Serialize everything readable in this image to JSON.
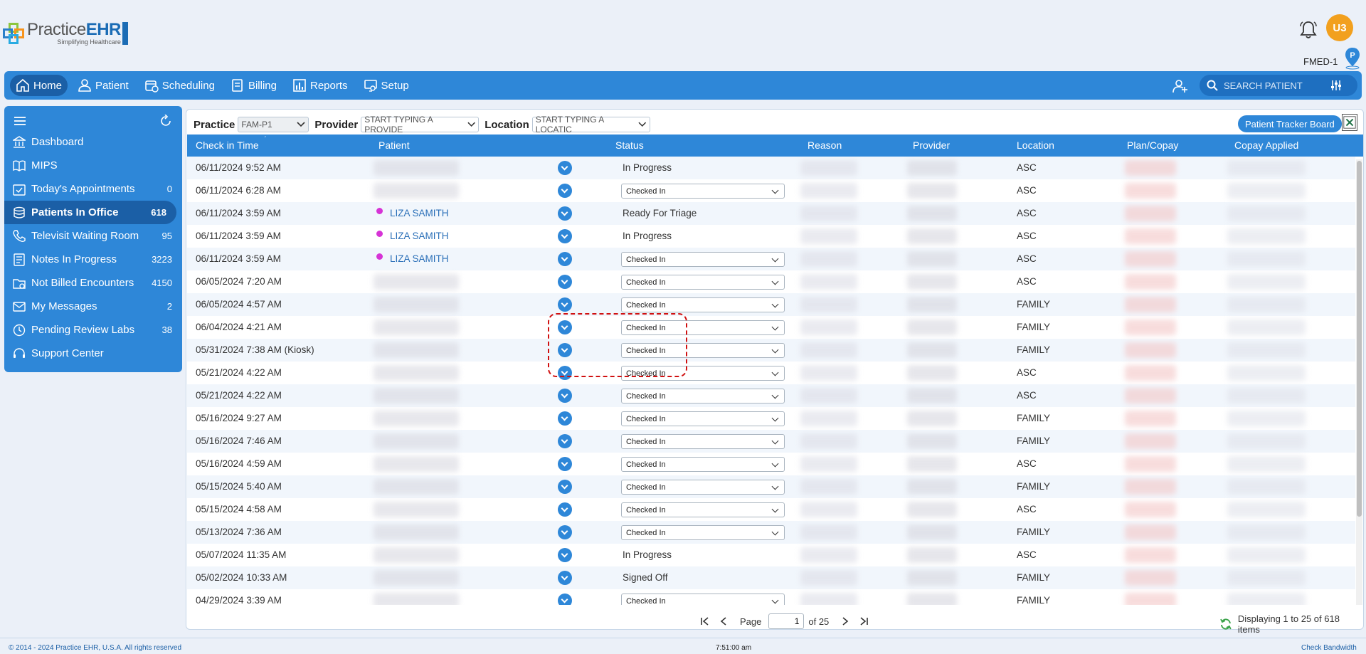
{
  "app": {
    "brand_practice": "Practice",
    "brand_ehr": "EHR",
    "tagline": "Simplifying Healthcare",
    "user_initials": "U3",
    "facility": "FMED-1",
    "pin_letter": "P"
  },
  "nav": {
    "items": [
      {
        "label": "Home",
        "icon": "home-icon"
      },
      {
        "label": "Patient",
        "icon": "user-icon"
      },
      {
        "label": "Scheduling",
        "icon": "calendar-icon"
      },
      {
        "label": "Billing",
        "icon": "billing-icon"
      },
      {
        "label": "Reports",
        "icon": "chart-icon"
      },
      {
        "label": "Setup",
        "icon": "setup-icon"
      }
    ],
    "search_placeholder": "SEARCH PATIENT"
  },
  "sidebar": {
    "items": [
      {
        "label": "Dashboard",
        "count": ""
      },
      {
        "label": "MIPS",
        "count": ""
      },
      {
        "label": "Today's Appointments",
        "count": "0"
      },
      {
        "label": "Patients In Office",
        "count": "618"
      },
      {
        "label": "Televisit Waiting Room",
        "count": "95"
      },
      {
        "label": "Notes In Progress",
        "count": "3223"
      },
      {
        "label": "Not Billed Encounters",
        "count": "4150"
      },
      {
        "label": "My Messages",
        "count": "2"
      },
      {
        "label": "Pending Review Labs",
        "count": "38"
      },
      {
        "label": "Support Center",
        "count": ""
      }
    ]
  },
  "filters": {
    "practice_label": "Practice",
    "practice_value": "FAM-P1",
    "provider_label": "Provider",
    "provider_placeholder": "START TYPING A PROVIDE",
    "location_label": "Location",
    "location_placeholder": "START TYPING A LOCATIC",
    "tracker_button": "Patient Tracker Board"
  },
  "table": {
    "columns": [
      "Check in Time",
      "Patient",
      "Status",
      "Reason",
      "Provider",
      "Location",
      "Plan/Copay",
      "Copay Applied"
    ],
    "rows": [
      {
        "time": "06/11/2024 9:52 AM",
        "patient": "",
        "status": "In Progress",
        "status_type": "text",
        "location": "ASC"
      },
      {
        "time": "06/11/2024 6:28 AM",
        "patient": "",
        "status": "Checked In",
        "status_type": "select",
        "location": "ASC"
      },
      {
        "time": "06/11/2024 3:59 AM",
        "patient": "LIZA SAMITH",
        "status": "Ready For Triage",
        "status_type": "text",
        "location": "ASC"
      },
      {
        "time": "06/11/2024 3:59 AM",
        "patient": "LIZA SAMITH",
        "status": "In Progress",
        "status_type": "text",
        "location": "ASC"
      },
      {
        "time": "06/11/2024 3:59 AM",
        "patient": "LIZA SAMITH",
        "status": "Checked In",
        "status_type": "select",
        "location": "ASC"
      },
      {
        "time": "06/05/2024 7:20 AM",
        "patient": "",
        "status": "Checked In",
        "status_type": "select",
        "location": "ASC"
      },
      {
        "time": "06/05/2024 4:57 AM",
        "patient": "",
        "status": "Checked In",
        "status_type": "select",
        "location": "FAMILY"
      },
      {
        "time": "06/04/2024 4:21 AM",
        "patient": "",
        "status": "Checked In",
        "status_type": "select",
        "location": "FAMILY"
      },
      {
        "time": "05/31/2024 7:38 AM (Kiosk)",
        "patient": "",
        "status": "Checked In",
        "status_type": "select",
        "location": "FAMILY"
      },
      {
        "time": "05/21/2024 4:22 AM",
        "patient": "",
        "status": "Checked In",
        "status_type": "select",
        "location": "ASC"
      },
      {
        "time": "05/21/2024 4:22 AM",
        "patient": "",
        "status": "Checked In",
        "status_type": "select",
        "location": "ASC"
      },
      {
        "time": "05/16/2024 9:27 AM",
        "patient": "",
        "status": "Checked In",
        "status_type": "select",
        "location": "FAMILY"
      },
      {
        "time": "05/16/2024 7:46 AM",
        "patient": "",
        "status": "Checked In",
        "status_type": "select",
        "location": "FAMILY"
      },
      {
        "time": "05/16/2024 4:59 AM",
        "patient": "",
        "status": "Checked In",
        "status_type": "select",
        "location": "ASC"
      },
      {
        "time": "05/15/2024 5:40 AM",
        "patient": "",
        "status": "Checked In",
        "status_type": "select",
        "location": "FAMILY"
      },
      {
        "time": "05/15/2024 4:58 AM",
        "patient": "",
        "status": "Checked In",
        "status_type": "select",
        "location": "ASC"
      },
      {
        "time": "05/13/2024 7:36 AM",
        "patient": "",
        "status": "Checked In",
        "status_type": "select",
        "location": "FAMILY"
      },
      {
        "time": "05/07/2024 11:35 AM",
        "patient": "",
        "status": "In Progress",
        "status_type": "text",
        "location": "ASC"
      },
      {
        "time": "05/02/2024 10:33 AM",
        "patient": "",
        "status": "Signed Off",
        "status_type": "text",
        "location": "FAMILY"
      },
      {
        "time": "04/29/2024 3:39 AM",
        "patient": "",
        "status": "Checked In",
        "status_type": "select",
        "location": "FAMILY"
      }
    ]
  },
  "pager": {
    "page_label": "Page",
    "page_value": "1",
    "of_label": "of 25",
    "displaying": "Displaying 1 to 25 of 618 items"
  },
  "footer": {
    "copyright": "© 2014 - 2024 Practice EHR, U.S.A. All rights reserved",
    "time": "7:51:00 am",
    "bandwidth": "Check Bandwidth"
  },
  "colors": {
    "primary": "#2e87d8",
    "primary_dark": "#1b5fa6",
    "avatar": "#f2a01e",
    "patient_dot": "#d633d6",
    "highlight": "#d01010"
  }
}
